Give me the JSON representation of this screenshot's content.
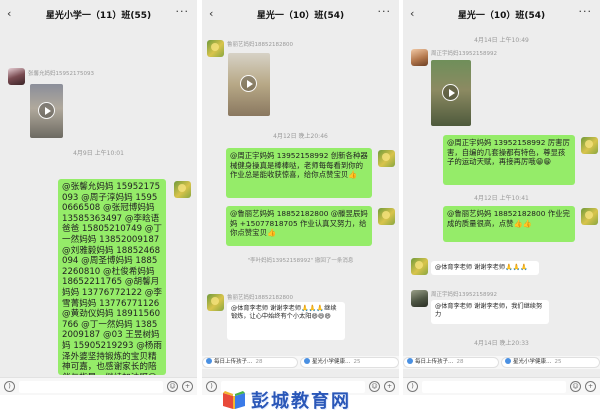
{
  "panels": [
    {
      "title": "星光小学一（11）班(55)",
      "sender_a": "张馨允妈妈15952175093",
      "timestamp_a": "4月9日 上午10:01",
      "message": "@张馨允妈妈 15952175093 @周子淳妈妈 15950666508 @张冠博妈妈 13585363497 @李晗语爸爸 15805210749 @丁一然妈妈 13852009187 @刘雅毅妈妈 18852468094 @周圣博妈妈 18852260810 @杜俊希妈妈 18652211765 @胡馨月妈妈 13776772122 @李雪菁妈妈 13776771126 @黄劲仪妈妈 18911560766 @丁一然妈妈 13852009187 @03 王昱树妈妈 15905219293 @杨雨泽外婆坚持锻炼的宝贝精神可嘉，也感谢家长的陪伴与指导，继续加油呀😁😁"
    },
    {
      "title": "星光一（10）班(54)",
      "sender_a": "鲁丽艺妈妈18852182800",
      "timestamp_a": "4月12日 晚上20:46",
      "message_a": "@周正宇妈妈 13952158992 创新各种器械健身操真是棒棒哒，老师每每看到你的作业总是能收获惊喜，给你点赞宝贝👍",
      "message_b": "@鲁丽艺妈妈 18852182800 @滕昱辰妈妈 +15077818705 作业认真又努力，给你点赞宝贝👍",
      "quote": "\"李叶妈妈13952158992\" 撤回了一条消息",
      "sender_b": "鲁丽艺妈妈18852182800",
      "message_c": "@体育李老师 谢谢李老师🙏🙏🙏继续锻炼，让心中始终有个小太阳😄😄😄",
      "chip_1": "每日上传孩子…",
      "chip_1_count": "28",
      "chip_2": "星光小学健康…",
      "chip_2_count": "25"
    },
    {
      "title": "星光一（10）班(54)",
      "timestamp_a": "4月14日 上午10:49",
      "sender_a": "周正宇妈妈13952158992",
      "message_a": "@周正宇妈妈 13952158992 厉害厉害，自编的几套操都有特色，尊显孩子的运动天赋，再接再厉哦😁😁",
      "timestamp_b": "4月12日 上午10:41",
      "message_b": "@鲁丽艺妈妈 18852182800 作业完成的质量很高，点赞👍👍",
      "message_c": "@体育李老师 谢谢李老师🙏🙏🙏",
      "sender_b": "周正宇妈妈13952158992",
      "message_d": "@体育李老师 谢谢李老师，我们继续努力",
      "timestamp_c": "4月14日 晚上20:33",
      "chip_1": "每日上传孩子…",
      "chip_1_count": "28",
      "chip_2": "星光小学健康…",
      "chip_2_count": "25"
    }
  ],
  "watermark": {
    "brand": "彭城教育网",
    "logo": "book-logo-icon"
  },
  "colors": {
    "bubble_green": "#95ec69",
    "chat_bg": "#ededed",
    "brand_blue": "#2a57b8"
  },
  "icons": {
    "back": "chevron-left-icon",
    "more": "more-dots-icon",
    "voice": "voice-icon",
    "emoji": "emoji-icon",
    "plus": "plus-icon",
    "play": "play-icon"
  }
}
